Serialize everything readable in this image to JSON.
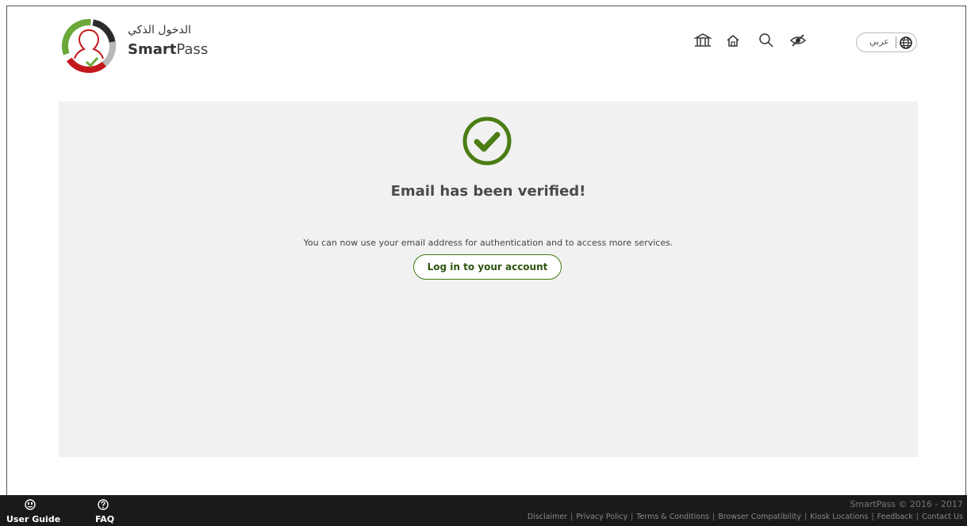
{
  "brand": {
    "arabic_name": "الدخول الذكي",
    "name_bold": "Smart",
    "name_regular": "Pass"
  },
  "header": {
    "icons": [
      "government-icon",
      "home-icon",
      "search-icon",
      "accessibility-eye-icon"
    ],
    "language_button_label": "عربي",
    "language_icon": "globe-icon"
  },
  "main": {
    "status_icon": "check-circle-icon",
    "title": "Email has been verified!",
    "description": "You can now use your email address for authentication and to access more services.",
    "login_button_label": "Log in to your account"
  },
  "footer": {
    "user_guide_label": "User Guide",
    "user_guide_icon": "smiley-icon",
    "faq_label": "FAQ",
    "faq_icon": "question-icon",
    "copyright": "SmartPass © 2016 - 2017",
    "links": [
      "Disclaimer",
      "Privacy Policy",
      "Terms & Conditions",
      "Browser Compatibility",
      "Kiosk Locations",
      "Feedback",
      "Contact Us"
    ]
  },
  "colors": {
    "accent_green": "#4a7d14",
    "panel_bg": "#f1f1f1",
    "footer_bg": "#1a1a1a"
  }
}
